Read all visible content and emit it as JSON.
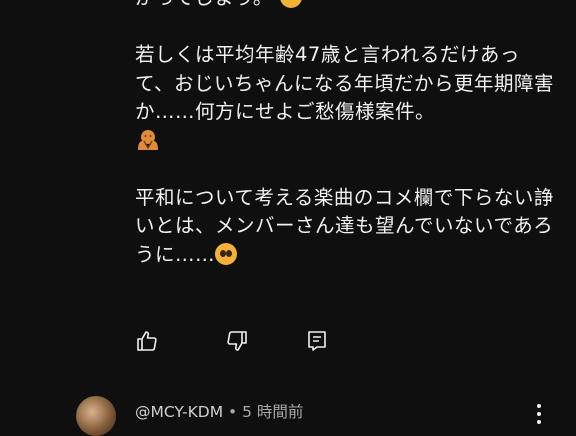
{
  "comment": {
    "partial_line_top": "がってしまう。",
    "paragraph_2": "若しくは平均年齢47歳と言われるだけあって、おじいちゃんになる年頃だから更年期障害か……何方にせよご愁傷様案件。",
    "paragraph_3": "平和について考える楽曲のコメ欄で下らない諍いとは、メンバーさん達も望んでいないであろうに……",
    "emojis": [
      "worried-face",
      "pleading-hands",
      "pleading-face"
    ]
  },
  "actions": {
    "like_icon": "thumbs-up-icon",
    "dislike_icon": "thumbs-down-icon",
    "reply_icon": "reply-comment-icon"
  },
  "next_comment": {
    "author": "@MCY-KDM",
    "separator": " • ",
    "time": "5 時間前",
    "menu_icon": "more-vert-icon"
  },
  "colors": {
    "background": "#0f0f0f",
    "text": "#f1f1f1",
    "secondary_text": "#aaaaaa",
    "emoji": "#f2b23a"
  }
}
